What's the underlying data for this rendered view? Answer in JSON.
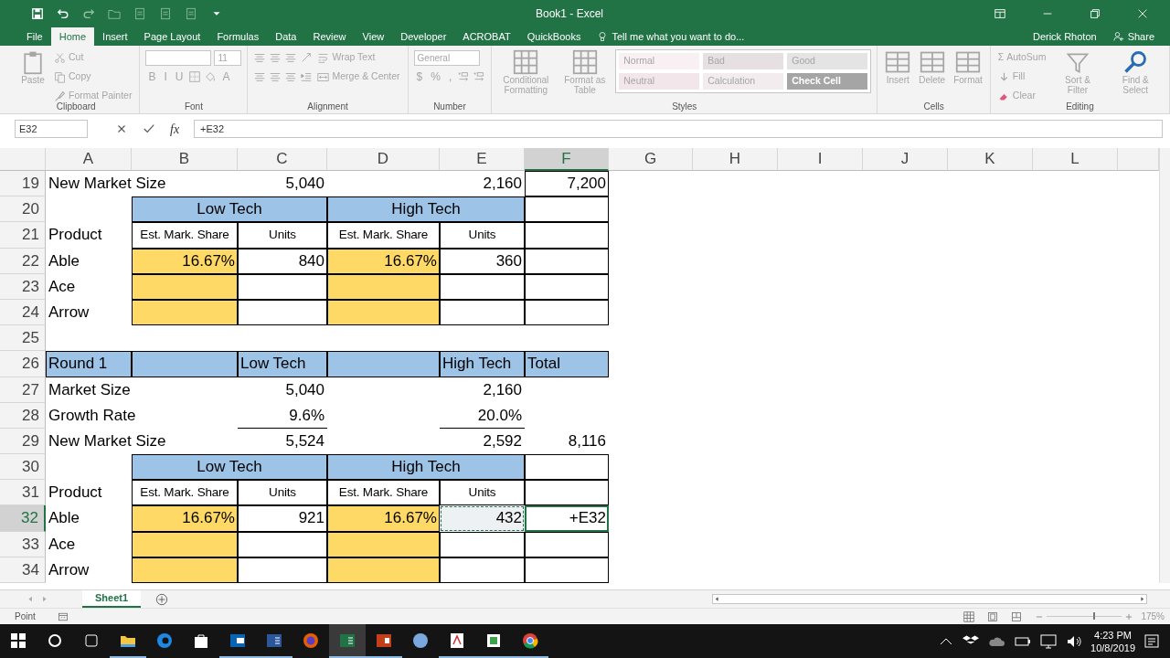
{
  "title_bar": {
    "title": "Book1 - Excel"
  },
  "ribbon_tabs": [
    {
      "label": "File",
      "selected": false
    },
    {
      "label": "Home",
      "selected": true
    },
    {
      "label": "Insert",
      "selected": false
    },
    {
      "label": "Page Layout",
      "selected": false
    },
    {
      "label": "Formulas",
      "selected": false
    },
    {
      "label": "Data",
      "selected": false
    },
    {
      "label": "Review",
      "selected": false
    },
    {
      "label": "View",
      "selected": false
    },
    {
      "label": "Developer",
      "selected": false
    },
    {
      "label": "ACROBAT",
      "selected": false
    },
    {
      "label": "QuickBooks",
      "selected": false
    }
  ],
  "tell_me": {
    "label": "Tell me what you want to do..."
  },
  "user": {
    "name": "Derick Rhoton",
    "share": "Share"
  },
  "ribbon": {
    "disabled": true,
    "groups": [
      {
        "label": "Clipboard",
        "buttons": [
          "Paste",
          "Cut",
          "Copy",
          "Format Painter"
        ]
      },
      {
        "label": "Font",
        "font_size": "11",
        "buttons": [
          "B",
          "I",
          "U",
          "A"
        ]
      },
      {
        "label": "Alignment",
        "buttons": [
          "Wrap Text",
          "Merge & Center"
        ]
      },
      {
        "label": "Number",
        "format": "General",
        "buttons": [
          "$",
          "%",
          ","
        ]
      },
      {
        "label": "Styles",
        "buttons": [
          "Conditional Formatting",
          "Format as Table"
        ],
        "styles": [
          {
            "label": "Normal",
            "color": "#f8f0f2"
          },
          {
            "label": "Bad",
            "color": "#e6e0e2"
          },
          {
            "label": "Good",
            "color": "#e4e4e4"
          },
          {
            "label": "Neutral",
            "color": "#f3e6ea"
          },
          {
            "label": "Calculation",
            "color": "#f2ecef"
          },
          {
            "label": "Check Cell",
            "color": "#a5a5a5"
          }
        ]
      },
      {
        "label": "Cells",
        "buttons": [
          "Insert",
          "Delete",
          "Format"
        ]
      },
      {
        "label": "Editing",
        "sigma": "Σ",
        "buttons": [
          "AutoSum",
          "Fill",
          "Clear",
          "Sort & Filter",
          "Find & Select"
        ]
      }
    ]
  },
  "formula_bar": {
    "name_box": "E32",
    "function": "fx",
    "formula": "+E32"
  },
  "columns": [
    {
      "label": "A",
      "selected": false
    },
    {
      "label": "B",
      "selected": false
    },
    {
      "label": "C",
      "selected": false
    },
    {
      "label": "D",
      "selected": false
    },
    {
      "label": "E",
      "selected": false
    },
    {
      "label": "F",
      "selected": true
    },
    {
      "label": "G",
      "selected": false
    },
    {
      "label": "H",
      "selected": false
    },
    {
      "label": "I",
      "selected": false
    },
    {
      "label": "J",
      "selected": false
    },
    {
      "label": "K",
      "selected": false
    },
    {
      "label": "L",
      "selected": false
    }
  ],
  "rows": [
    {
      "number": "19",
      "selected": false,
      "cells": [
        {
          "kind": "text",
          "text": "New Market Size"
        },
        {
          "kind": "blank"
        },
        {
          "kind": "number",
          "text": "5,040"
        },
        {
          "kind": "blank"
        },
        {
          "kind": "number",
          "text": "2,160"
        },
        {
          "kind": "entry",
          "text": "7,200"
        }
      ]
    },
    {
      "number": "20",
      "selected": false,
      "cells": [
        {
          "kind": "blank"
        },
        {
          "kind": "band",
          "text": "Low Tech"
        },
        {
          "kind": "band",
          "text": "High Tech"
        },
        {
          "kind": "entry"
        }
      ]
    },
    {
      "number": "21",
      "selected": false,
      "cells": [
        {
          "kind": "text",
          "text": "Product"
        },
        {
          "kind": "column_label",
          "text": "Est. Mark. Share"
        },
        {
          "kind": "column_label",
          "text": "Units"
        },
        {
          "kind": "column_label",
          "text": "Est. Mark. Share"
        },
        {
          "kind": "column_label",
          "text": "Units"
        },
        {
          "kind": "entry"
        }
      ]
    },
    {
      "number": "22",
      "selected": false,
      "cells": [
        {
          "kind": "text",
          "text": "Able"
        },
        {
          "kind": "input",
          "text": "16.67%"
        },
        {
          "kind": "entry",
          "text": "840"
        },
        {
          "kind": "input",
          "text": "16.67%"
        },
        {
          "kind": "entry",
          "text": "360"
        },
        {
          "kind": "entry"
        }
      ]
    },
    {
      "number": "23",
      "selected": false,
      "cells": [
        {
          "kind": "text",
          "text": "Ace"
        },
        {
          "kind": "input"
        },
        {
          "kind": "entry"
        },
        {
          "kind": "input"
        },
        {
          "kind": "entry"
        },
        {
          "kind": "entry"
        }
      ]
    },
    {
      "number": "24",
      "selected": false,
      "cells": [
        {
          "kind": "text",
          "text": "Arrow"
        },
        {
          "kind": "input"
        },
        {
          "kind": "entry"
        },
        {
          "kind": "input"
        },
        {
          "kind": "entry"
        },
        {
          "kind": "entry"
        }
      ]
    },
    {
      "number": "25",
      "selected": false
    },
    {
      "number": "26",
      "selected": false,
      "cells": [
        {
          "kind": "heading",
          "text": "Round  1"
        },
        {
          "kind": "heading"
        },
        {
          "kind": "heading",
          "text": "Low Tech"
        },
        {
          "kind": "heading"
        },
        {
          "kind": "heading",
          "text": "High Tech"
        },
        {
          "kind": "heading",
          "text": "Total"
        }
      ]
    },
    {
      "number": "27",
      "selected": false,
      "cells": [
        {
          "kind": "text",
          "text": "Market Size"
        },
        {
          "kind": "blank"
        },
        {
          "kind": "number",
          "text": "5,040"
        },
        {
          "kind": "blank"
        },
        {
          "kind": "number",
          "text": "2,160"
        }
      ]
    },
    {
      "number": "28",
      "selected": false,
      "cells": [
        {
          "kind": "text",
          "text": "Growth Rate"
        },
        {
          "kind": "blank"
        },
        {
          "kind": "subtotal",
          "text": "9.6%"
        },
        {
          "kind": "blank"
        },
        {
          "kind": "subtotal",
          "text": "20.0%"
        }
      ]
    },
    {
      "number": "29",
      "selected": false,
      "cells": [
        {
          "kind": "text",
          "text": "New Market Size"
        },
        {
          "kind": "blank"
        },
        {
          "kind": "number",
          "text": "5,524"
        },
        {
          "kind": "blank"
        },
        {
          "kind": "number",
          "text": "2,592"
        },
        {
          "kind": "number",
          "text": "8,116"
        }
      ]
    },
    {
      "number": "30",
      "selected": false,
      "cells": [
        {
          "kind": "blank"
        },
        {
          "kind": "band",
          "text": "Low Tech"
        },
        {
          "kind": "band",
          "text": "High Tech"
        },
        {
          "kind": "entry"
        }
      ]
    },
    {
      "number": "31",
      "selected": false,
      "cells": [
        {
          "kind": "text",
          "text": "Product"
        },
        {
          "kind": "column_label",
          "text": "Est. Mark. Share"
        },
        {
          "kind": "column_label",
          "text": "Units"
        },
        {
          "kind": "column_label",
          "text": "Est. Mark. Share"
        },
        {
          "kind": "column_label",
          "text": "Units"
        },
        {
          "kind": "entry"
        }
      ]
    },
    {
      "number": "32",
      "selected": true,
      "cells": [
        {
          "kind": "text",
          "text": "Able"
        },
        {
          "kind": "input",
          "text": "16.67%"
        },
        {
          "kind": "entry",
          "text": "921"
        },
        {
          "kind": "input",
          "text": "16.67%"
        },
        {
          "kind": "entry",
          "text": "432",
          "marquee": true,
          "editing": false
        },
        {
          "kind": "entry",
          "text": "+E32",
          "marquee": false,
          "editing": true
        }
      ]
    },
    {
      "number": "33",
      "selected": false,
      "cells": [
        {
          "kind": "text",
          "text": "Ace"
        },
        {
          "kind": "input"
        },
        {
          "kind": "entry"
        },
        {
          "kind": "input"
        },
        {
          "kind": "entry"
        },
        {
          "kind": "entry"
        }
      ]
    },
    {
      "number": "34",
      "selected": false,
      "cells": [
        {
          "kind": "text",
          "text": "Arrow"
        },
        {
          "kind": "input"
        },
        {
          "kind": "entry"
        },
        {
          "kind": "input"
        },
        {
          "kind": "entry"
        },
        {
          "kind": "entry"
        }
      ]
    }
  ],
  "sheet_tabs": [
    {
      "label": "Sheet1",
      "selected": true
    }
  ],
  "status_bar": {
    "mode": "Point",
    "zoom": "175%",
    "zoom_slider": {
      "level": 0.62
    }
  },
  "taskbar": {
    "apps": [
      {
        "running": true,
        "selected": false
      },
      {
        "running": false,
        "selected": false
      },
      {
        "running": false,
        "selected": false
      },
      {
        "running": true,
        "selected": false
      },
      {
        "running": true,
        "selected": false
      },
      {
        "running": false,
        "selected": false
      },
      {
        "running": true,
        "selected": true
      },
      {
        "running": true,
        "selected": false
      },
      {
        "running": false,
        "selected": false
      },
      {
        "running": true,
        "selected": false
      },
      {
        "running": true,
        "selected": false
      },
      {
        "running": true,
        "selected": false
      }
    ],
    "time": "4:23 PM",
    "date": "10/8/2019"
  }
}
